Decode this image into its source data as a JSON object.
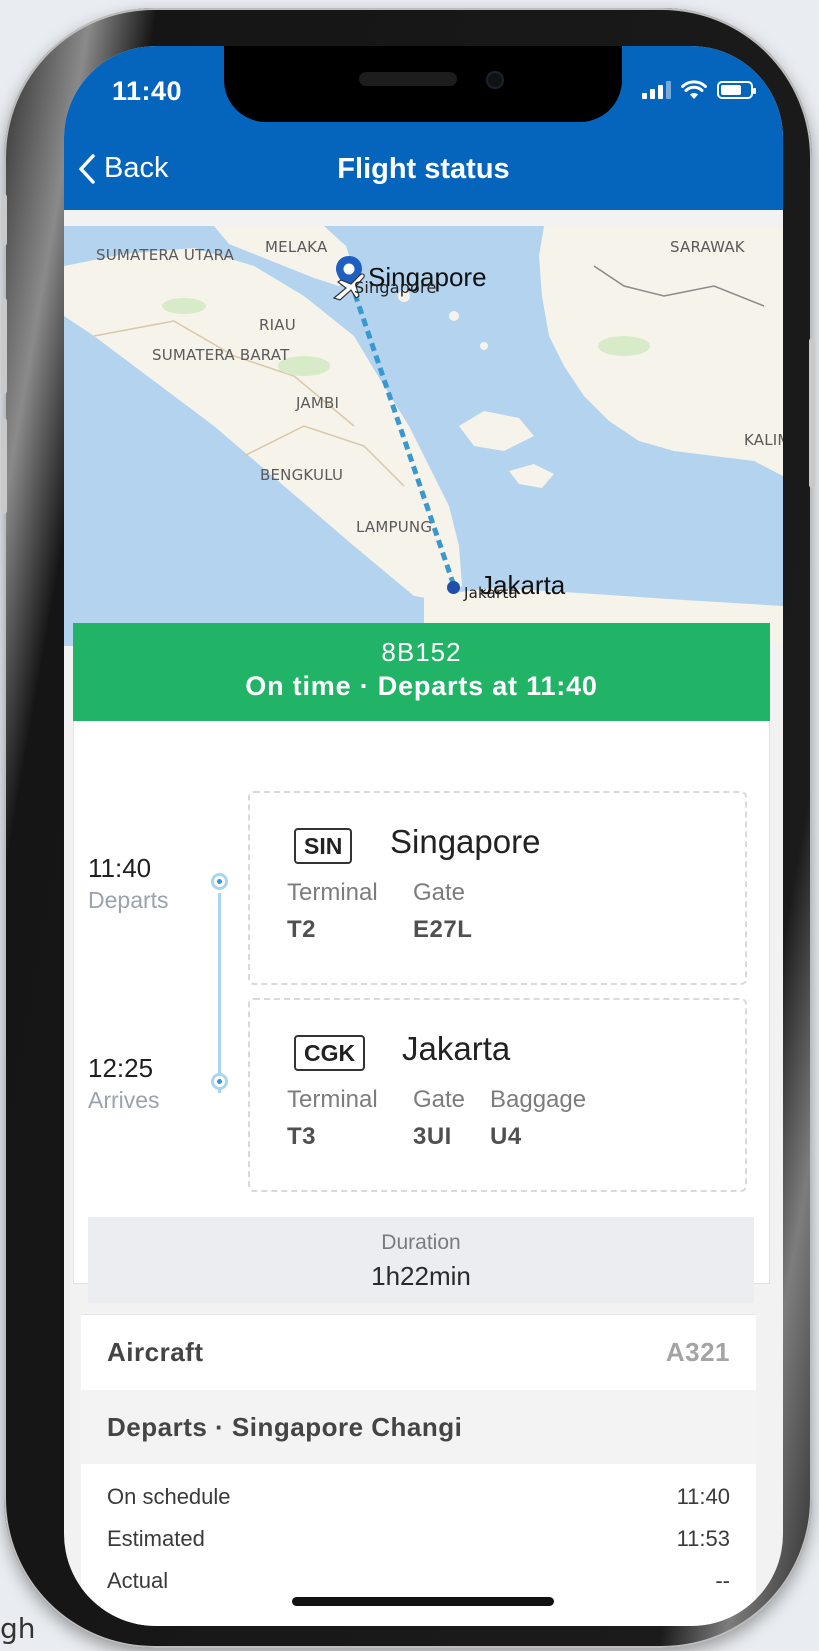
{
  "status_bar": {
    "time": "11:40",
    "icons": [
      "signal-icon",
      "wifi-icon",
      "battery-icon"
    ]
  },
  "nav": {
    "back_label": "Back",
    "title": "Flight status"
  },
  "map": {
    "regions": [
      "SUMATERA UTARA",
      "MELAKA",
      "SARAWAK",
      "RIAU",
      "SUMATERA BARAT",
      "JAMBI",
      "BENGKULU",
      "LAMPUNG",
      "KALIM"
    ],
    "origin_label": "Singapore",
    "origin_sublabel": "Singapore",
    "destination_label": "Jakarta",
    "destination_sublabel": "Jakarta"
  },
  "flight": {
    "number": "8B152",
    "status_line": "On time · Departs at 11:40",
    "status_color": "#21b466"
  },
  "departure": {
    "time": "11:40",
    "time_label": "Departs",
    "code": "SIN",
    "city": "Singapore",
    "terminal_label": "Terminal",
    "terminal": "T2",
    "gate_label": "Gate",
    "gate": "E27L"
  },
  "arrival": {
    "time": "12:25",
    "time_label": "Arrives",
    "code": "CGK",
    "city": "Jakarta",
    "terminal_label": "Terminal",
    "terminal": "T3",
    "gate_label": "Gate",
    "gate": "3UI",
    "baggage_label": "Baggage",
    "baggage": "U4"
  },
  "duration": {
    "label": "Duration",
    "value": "1h22min"
  },
  "aircraft": {
    "label": "Aircraft",
    "value": "A321"
  },
  "departs_section": {
    "title": "Departs · Singapore Changi",
    "rows": [
      {
        "label": "On schedule",
        "value": "11:40"
      },
      {
        "label": "Estimated",
        "value": "11:53"
      },
      {
        "label": "Actual",
        "value": "--"
      }
    ]
  },
  "background_text": "gh",
  "colors": {
    "header": "#0565bd",
    "status": "#21b466",
    "route_line": "#3a98d0"
  }
}
